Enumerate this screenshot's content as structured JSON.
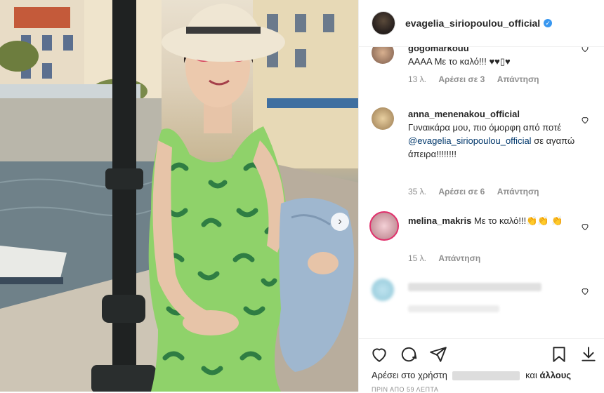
{
  "post": {
    "username": "evagelia_siriopoulou_official",
    "verified_icon": "verified-badge-icon"
  },
  "comments": [
    {
      "username": "gogomarkouu",
      "text_visible": "ΑΑΑΑ Με το καλό!!! ♥♥▯♥",
      "age": "13 λ.",
      "likes": "Αρέσει σε 3",
      "reply": "Απάντηση"
    },
    {
      "username": "anna_menenakou_official",
      "text": "Γυναικάρα μου, πιο όμορφη από ποτέ",
      "mention": "@evagelia_siriopoulou_official",
      "text_after": "σε αγαπώ άπειρα!!!!!!!!",
      "age": "35 λ.",
      "likes": "Αρέσει σε 6",
      "reply": "Απάντηση"
    },
    {
      "username": "melina_makris",
      "text": "Με το καλό!!!👏👏 👏",
      "age": "15 λ.",
      "reply": "Απάντηση"
    },
    {
      "username": "",
      "text": "",
      "age": "",
      "reply": ""
    }
  ],
  "likes_line": {
    "prefix": "Αρέσει στο χρήστη",
    "suffix_and": "και",
    "suffix_others": "άλλους"
  },
  "timestamp": "ΠΡΙΝ ΑΠΟ 59 ΛΕΠΤΑ",
  "colors": {
    "accent": "#3897f0",
    "text": "#262626",
    "muted": "#8e8e8e",
    "mention": "#00376b",
    "border": "#efefef"
  }
}
